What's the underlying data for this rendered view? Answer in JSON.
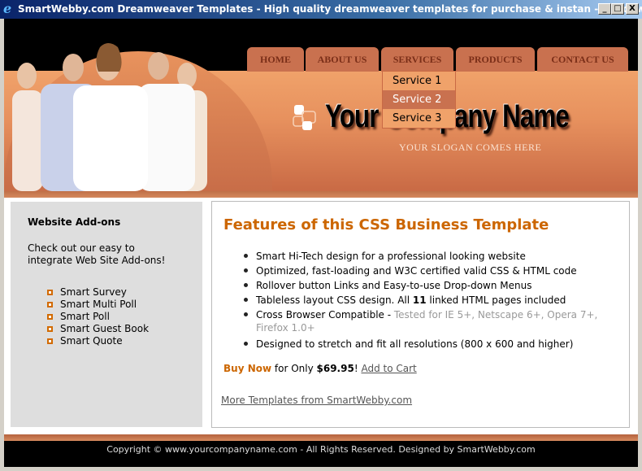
{
  "window": {
    "title": "SmartWebby.com Dreamweaver Templates - High quality dreamweaver templates for purchase & instan - Windows Interne...",
    "icon": "ie-icon",
    "minimize": "_",
    "maximize": "□",
    "close": "X"
  },
  "header": {
    "company": "Your Company Name",
    "slogan": "YOUR SLOGAN COMES HERE",
    "nav": [
      {
        "label": "HOME"
      },
      {
        "label": "ABOUT US"
      },
      {
        "label": "SERVICES"
      },
      {
        "label": "PRODUCTS"
      },
      {
        "label": "CONTACT US"
      }
    ],
    "dropdown": [
      {
        "label": "Service 1"
      },
      {
        "label": "Service 2",
        "active": true
      },
      {
        "label": "Service 3"
      }
    ]
  },
  "sidebar": {
    "title": "Website Add-ons",
    "intro": "Check out our easy to integrate Web Site Add-ons!",
    "items": [
      "Smart Survey",
      "Smart Multi Poll",
      "Smart Poll",
      "Smart Guest Book",
      "Smart Quote"
    ]
  },
  "main": {
    "title": "Features of this CSS Business Template",
    "features": [
      "Smart Hi-Tech design for a professional looking website",
      "Optimized, fast-loading and W3C certified valid CSS & HTML code",
      "Rollover button Links and Easy-to-use Drop-down Menus"
    ],
    "f4_pre": "Tableless layout CSS design. All ",
    "f4_bold": "11",
    "f4_post": " linked HTML pages included",
    "f5_pre": "Cross Browser Compatible - ",
    "f5_gray": "Tested for IE 5+, Netscape 6+, Opera 7+, Firefox 1.0+",
    "f6": "Designed to stretch and fit all resolutions (800 x 600 and higher)",
    "buy_now": "Buy Now",
    "for_only": " for Only ",
    "price": "$69.95",
    "bang": "!",
    "add_to_cart": "Add to Cart",
    "more": "More Templates from SmartWebby.com"
  },
  "footer": {
    "text": "Copyright © www.yourcompanyname.com - All Rights Reserved. Designed by SmartWebby.com"
  },
  "colors": {
    "accent": "#cc6600",
    "nav": "#c9714f",
    "band": "#e7915e"
  }
}
